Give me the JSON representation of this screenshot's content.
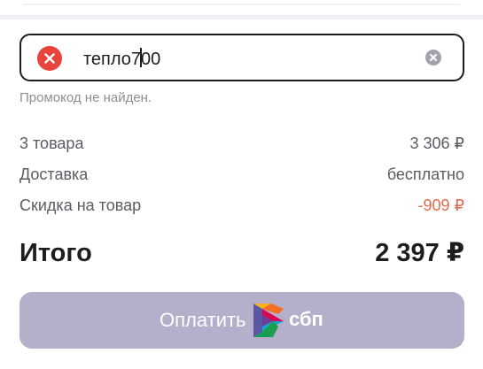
{
  "promo": {
    "value_before_caret": "тепло7",
    "value_after_caret": "00",
    "error_text": "Промокод не найден."
  },
  "summary": {
    "items_label": "3 товара",
    "items_value": "3 306 ₽",
    "delivery_label": "Доставка",
    "delivery_value": "бесплатно",
    "discount_label": "Скидка на товар",
    "discount_value": "-909 ₽"
  },
  "total": {
    "label": "Итого",
    "value": "2 397 ₽"
  },
  "pay_button": {
    "label": "Оплатить",
    "sbp_text": "сбп"
  },
  "colors": {
    "error": "#e8443a",
    "discount": "#e06a4e",
    "button_bg": "#b4afca"
  },
  "icons": [
    "error-icon",
    "clear-icon",
    "sbp-logo-icon"
  ]
}
